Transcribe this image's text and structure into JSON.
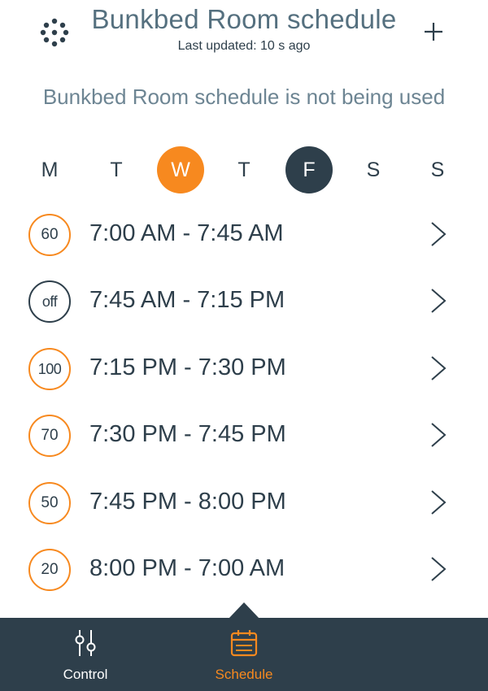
{
  "header": {
    "title": "Bunkbed Room schedule",
    "subtitle": "Last updated: 10 s ago",
    "menu_icon": "dots-grid-icon",
    "add_icon": "plus-icon"
  },
  "status_message": "Bunkbed Room schedule is not being used",
  "days": [
    {
      "label": "M",
      "state": "normal"
    },
    {
      "label": "T",
      "state": "normal"
    },
    {
      "label": "W",
      "state": "today"
    },
    {
      "label": "T",
      "state": "normal"
    },
    {
      "label": "F",
      "state": "selected"
    },
    {
      "label": "S",
      "state": "normal"
    },
    {
      "label": "S",
      "state": "normal"
    }
  ],
  "schedule": [
    {
      "level": "60",
      "range": "7:00 AM - 7:45 AM"
    },
    {
      "level": "off",
      "range": "7:45 AM - 7:15 PM"
    },
    {
      "level": "100",
      "range": "7:15 PM - 7:30 PM"
    },
    {
      "level": "70",
      "range": "7:30 PM - 7:45 PM"
    },
    {
      "level": "50",
      "range": "7:45 PM - 8:00 PM"
    },
    {
      "level": "20",
      "range": "8:00 PM - 7:00 AM"
    }
  ],
  "nav": {
    "control_label": "Control",
    "schedule_label": "Schedule",
    "active": "schedule"
  },
  "colors": {
    "accent": "#f7891f",
    "dark": "#2e3f4b",
    "muted": "#6d8593"
  }
}
